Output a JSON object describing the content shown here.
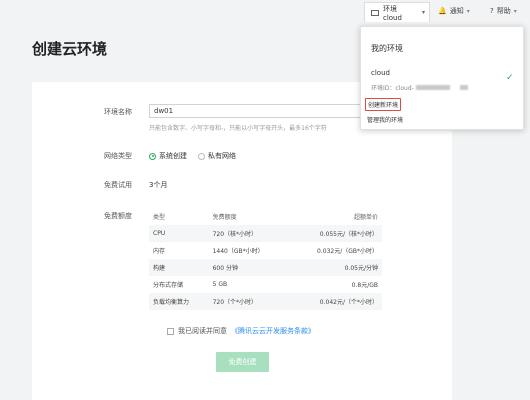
{
  "topbar": {
    "env_switch_label": "环境 cloud",
    "notify_label": "通知",
    "help_label": "帮助"
  },
  "page_title": "创建云环境",
  "form": {
    "env_name_label": "环境名称",
    "env_name_value": "dw01",
    "env_name_hint": "只能包含数字、小写字母和-，只能以小写字母开头，最多16个字符",
    "network_label": "网络类型",
    "network_options": [
      "系统创建",
      "私有网络"
    ],
    "trial_label": "免费试用",
    "trial_value": "3个月",
    "quota_label": "免费额度",
    "table_headers": [
      "类型",
      "免费额度",
      "超额单价"
    ],
    "table_rows": [
      [
        "CPU",
        "720（核*小时）",
        "0.055元/（核*小时）"
      ],
      [
        "内存",
        "1440（GB*小时）",
        "0.032元/（GB*小时）"
      ],
      [
        "构建",
        "600 分钟",
        "0.05元/分钟"
      ],
      [
        "分布式存储",
        "5 GB",
        "0.8元/GB"
      ],
      [
        "负载均衡算力",
        "720（个*小时）",
        "0.042元/（个*小时）"
      ]
    ],
    "agree_text": "我已阅读并同意",
    "agree_link": "《腾讯云云开发服务条款》",
    "submit_label": "免费创建"
  },
  "dropdown": {
    "title": "我的环境",
    "env_name": "cloud",
    "env_id_prefix": "环境ID：cloud-",
    "create_label": "创建新环境",
    "manage_label": "管理我的环境"
  },
  "colors": {
    "accent_green": "#2daa5f",
    "button_disabled": "#a8e0bf",
    "highlight_red": "#e04a3f",
    "link_blue": "#2d8cf0"
  }
}
